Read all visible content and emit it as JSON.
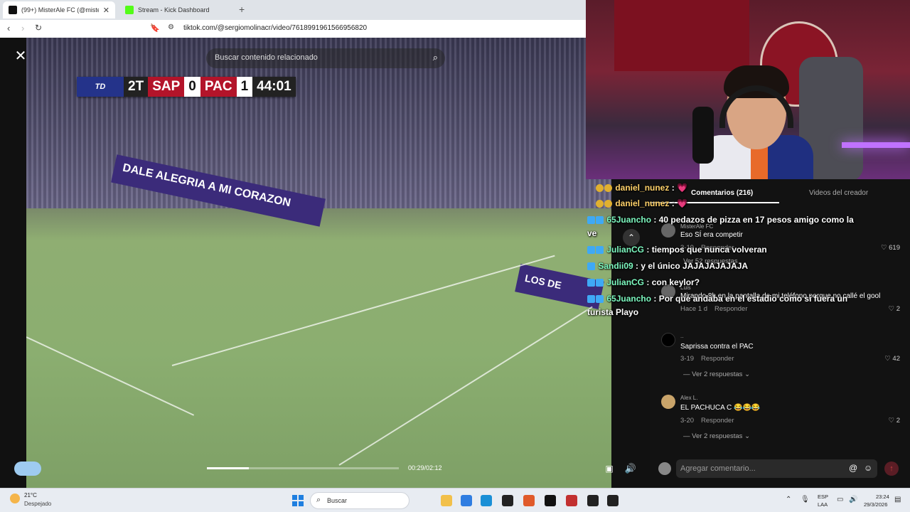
{
  "browser": {
    "tabs": [
      {
        "label": "(99+) MisterAle FC (@mistera",
        "favicon_color": "#111111",
        "active": true
      },
      {
        "label": "Stream - Kick Dashboard",
        "favicon_color": "#53fc18",
        "active": false
      }
    ],
    "url": "tiktok.com/@sergiomolinacr/video/7618991961566956820"
  },
  "video": {
    "search_placeholder": "Buscar contenido relacionado",
    "scoreboard": {
      "logo": "TD",
      "period": "2T",
      "home_team": "SAP",
      "home_score": "0",
      "away_team": "PAC",
      "away_score": "1",
      "clock": "44:01"
    },
    "banners": [
      "DALE ALEGRIA A MI CORAZON",
      "LOS DE"
    ],
    "time_readout": "00:29/02:12",
    "progress_fraction": 0.22
  },
  "comments": {
    "tabs": [
      "Comentarios (216)",
      "Videos del creador"
    ],
    "items": [
      {
        "user": "MisterAle FC",
        "text": "Eso SÍ era competir",
        "date": "3-19",
        "reply_label": "Responder",
        "likes": "619",
        "avatar_color": "#6a6a6a",
        "more": "Ver 52 respuestas"
      },
      {
        "user": "Luis",
        "text": "Mirando 8h en la pantalla de mi teléfono porque no callé el gool",
        "date": "Hace 1 d",
        "reply_label": "Responder",
        "likes": "2",
        "avatar_color": "#7a7a7a",
        "more": ""
      },
      {
        "user": "..",
        "text": "Saprissa contra el PAC",
        "date": "3-19",
        "reply_label": "Responder",
        "likes": "42",
        "avatar_color": "#111111",
        "more": "Ver 2 respuestas"
      },
      {
        "user": "Alex L.",
        "text": "EL PACHUCA C 😂😂😂",
        "date": "3-20",
        "reply_label": "Responder",
        "likes": "2",
        "avatar_color": "#c9a46a",
        "more": "Ver 2 respuestas"
      }
    ],
    "input_placeholder": "Agregar comentario..."
  },
  "chat": [
    {
      "user": "daniel_nunez",
      "message": "💗",
      "color": "gold"
    },
    {
      "user": "daniel_nunez",
      "message": "💗",
      "color": "gold"
    },
    {
      "user": "65Juancho",
      "message": "40 pedazos de pizza en 17 pesos amigo como la",
      "message2": "ve",
      "color": "green"
    },
    {
      "user": "JulianCG",
      "message": "tiempos que nunca volveran",
      "color": "green"
    },
    {
      "user": "Sandii09",
      "message": "y el único JAJAJAJAJAJA",
      "color": "green"
    },
    {
      "user": "JulianCG",
      "message": "con keylor?",
      "color": "green"
    },
    {
      "user": "65Juancho",
      "message": "Por que andaba en el estadio como si fuera un",
      "message2": "turista Playo",
      "color": "green"
    }
  ],
  "taskbar": {
    "weather_temp": "21°C",
    "weather_desc": "Despejado",
    "search_label": "Buscar",
    "lang1": "ESP",
    "lang2": "LAA",
    "time": "23:24",
    "date": "29/3/2026",
    "apps": [
      "#f2c04a",
      "#2f7de1",
      "#1a8fd6",
      "#222222",
      "#e05a2a",
      "#111111",
      "#c23030",
      "#222222",
      "#222222"
    ]
  },
  "colors": {
    "accent_red": "#fe2c55",
    "kick_green": "#53fc18"
  }
}
